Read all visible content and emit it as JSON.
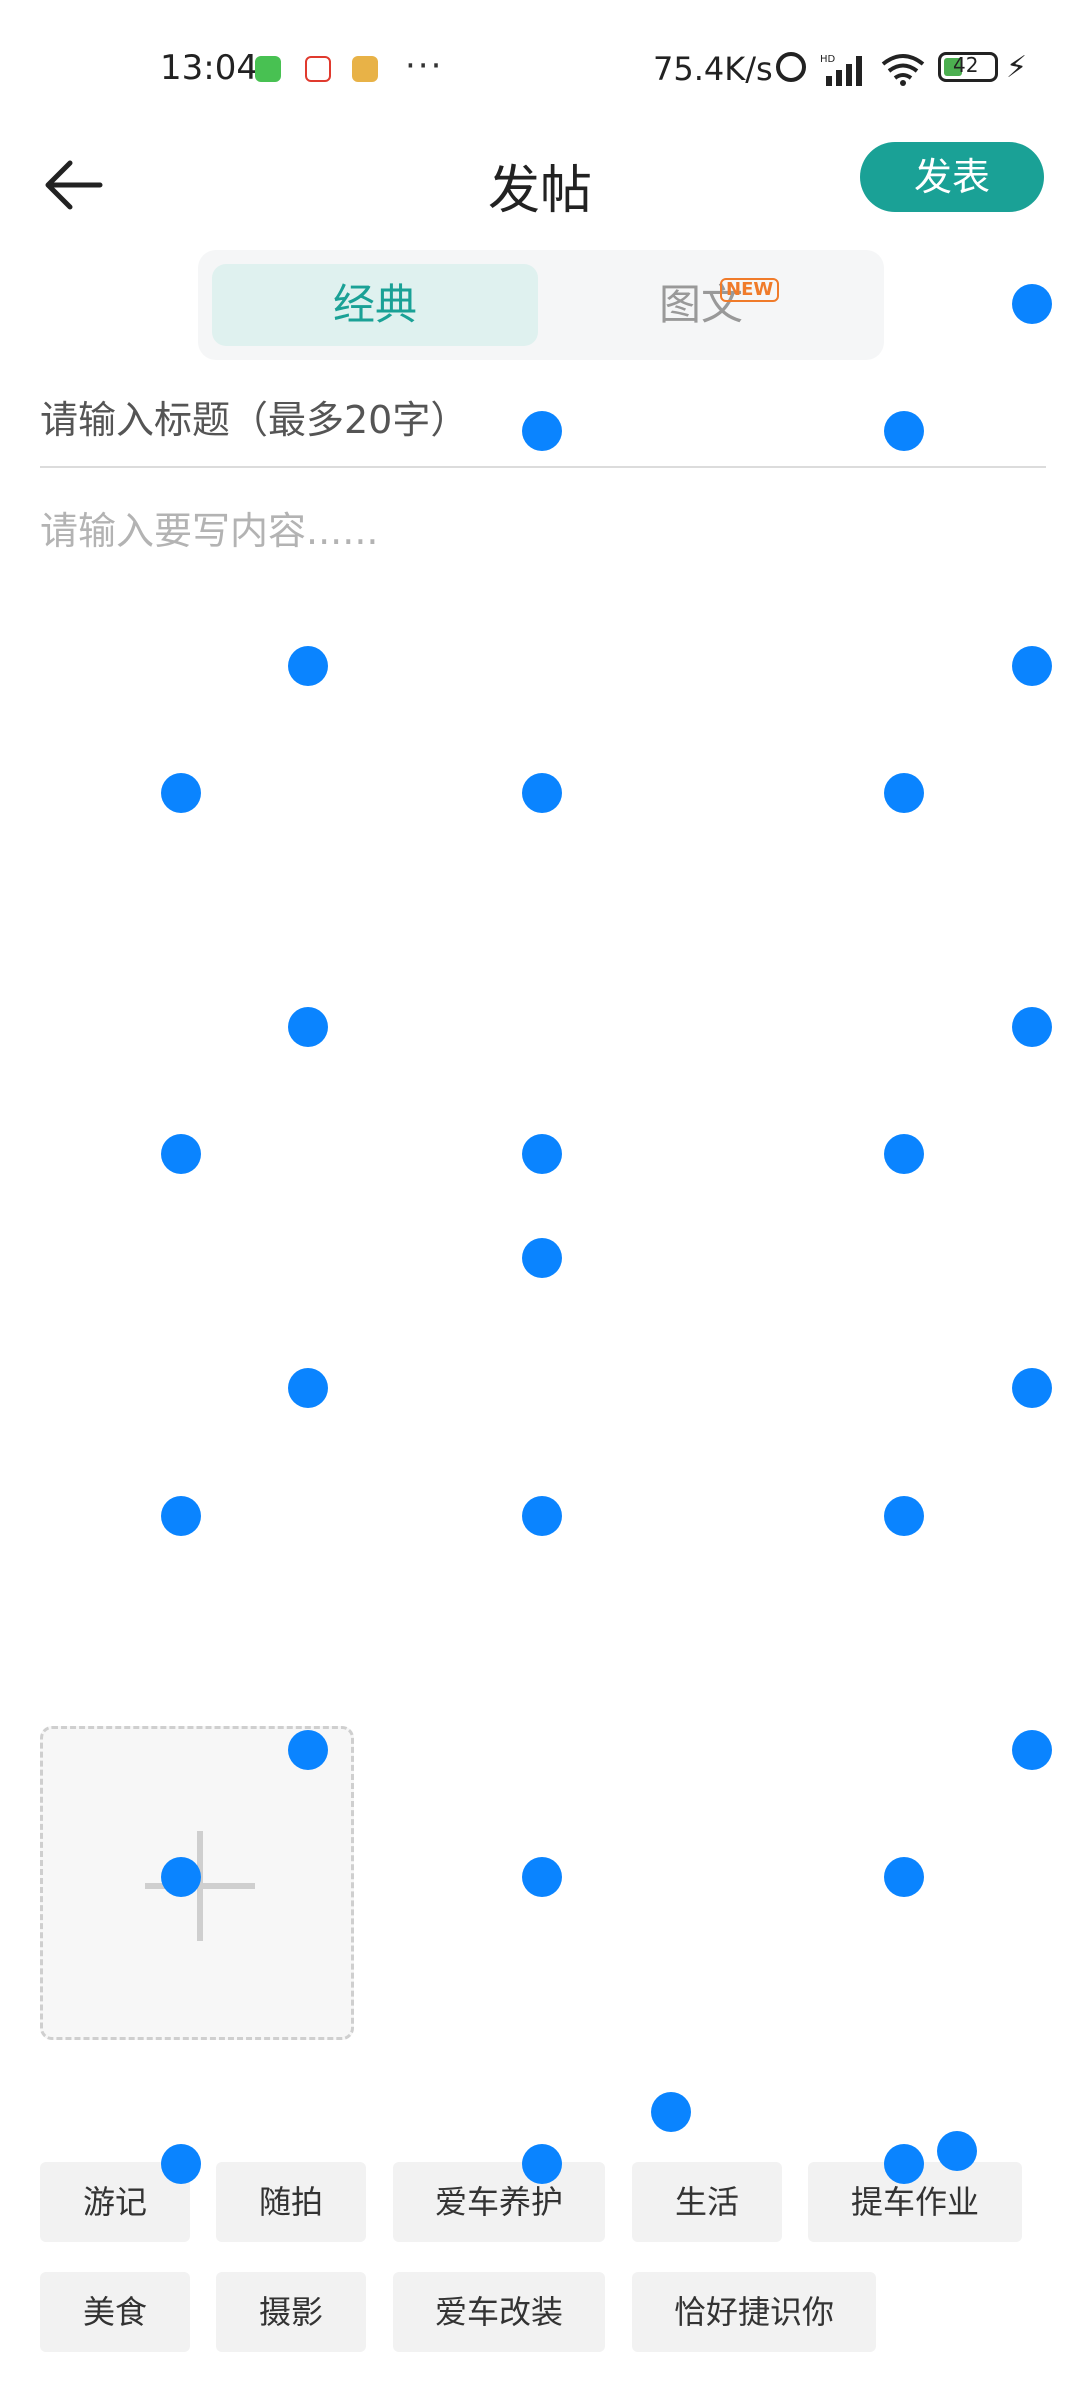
{
  "status_bar": {
    "time": "13:04",
    "dots": "···",
    "net_speed": "75.4K/s",
    "battery": "42",
    "icons": [
      "app-icon",
      "app-icon",
      "app-icon",
      "alarm-icon",
      "hd-signal-icon",
      "wifi-icon",
      "battery-icon",
      "charging-icon"
    ]
  },
  "header": {
    "title": "发帖",
    "publish_label": "发表"
  },
  "tabs": {
    "classic": "经典",
    "image_text": "图文",
    "new_badge": "NEW"
  },
  "form": {
    "title_placeholder": "请输入标题（最多20字）",
    "content_placeholder": "请输入要写内容......"
  },
  "tags": [
    "游记",
    "随拍",
    "爱车养护",
    "生活",
    "提车作业",
    "美食",
    "摄影",
    "爱车改装",
    "恰好捷识你"
  ],
  "colors": {
    "accent": "#1aa196",
    "overlay_dot": "#0a84ff"
  }
}
